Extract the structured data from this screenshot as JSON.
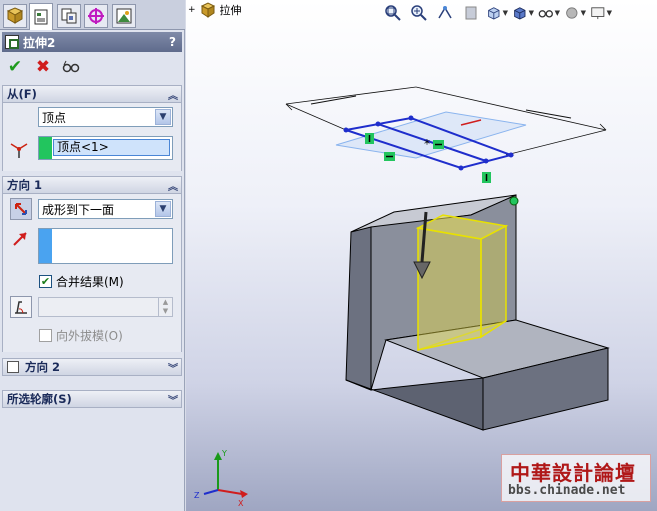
{
  "property_manager": {
    "title": "拉伸2",
    "help": "?",
    "tabs": [
      "feature-manager-icon",
      "property-manager-icon",
      "configuration-manager-icon",
      "dimxpert-icon",
      "display-manager-icon"
    ],
    "from": {
      "header": "从(F)",
      "condition": "顶点",
      "selection": "顶点<1>"
    },
    "direction1": {
      "header": "方向 1",
      "end_condition": "成形到下一面",
      "merge_label": "合并结果(M)",
      "merge_checked": true,
      "draft_label": "向外拔模(O)",
      "draft_checked": false
    },
    "direction2": {
      "header": "方向 2",
      "checked": false
    },
    "selected_contours": {
      "header": "所选轮廓(S)"
    }
  },
  "viewport": {
    "crumb_label": "拉伸"
  },
  "watermark": {
    "line1": "中華設計論壇",
    "line2": "bbs.chinade.net"
  },
  "colors": {
    "selection_green": "#22c55e",
    "sketch_blue": "#1f2ecc",
    "preview_yellow": "#e8e100",
    "solid_gray": "#8a8f9c"
  }
}
